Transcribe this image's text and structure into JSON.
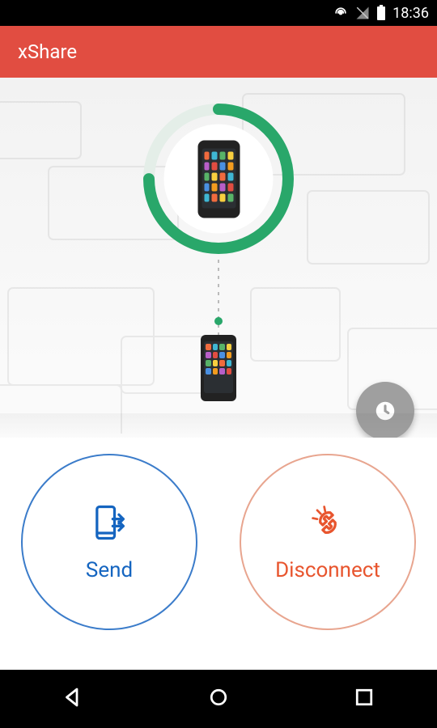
{
  "status": {
    "time": "18:36"
  },
  "app": {
    "title": "xShare"
  },
  "progress": {
    "percent": 75
  },
  "buttons": {
    "send_label": "Send",
    "disconnect_label": "Disconnect"
  },
  "colors": {
    "primary": "#e14d41",
    "progress_green": "#29a76a",
    "send_blue": "#1565c0",
    "disconnect_orange": "#e8552e"
  }
}
